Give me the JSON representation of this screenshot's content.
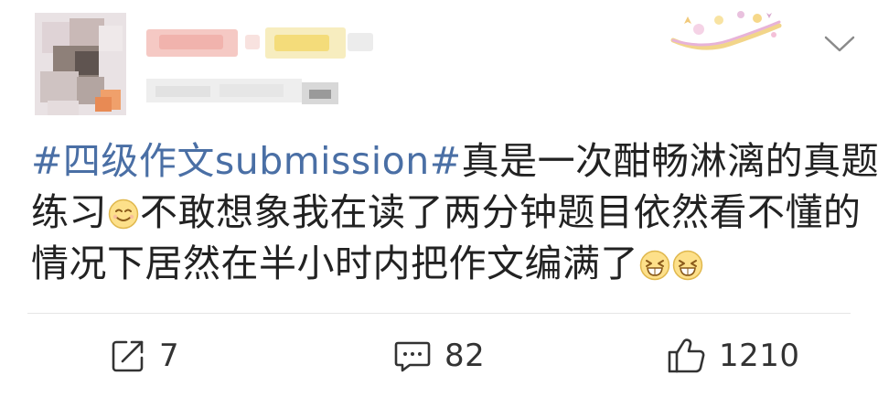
{
  "post": {
    "hashtag": "#四级作文submission#",
    "text_line1_rest": "真是一次酣畅淋漓的真题",
    "text_line2_a": "练习",
    "text_line2_b": "不敢想象我在读了两分钟题目依然看不懂的",
    "text_line3": "情况下居然在半小时内把作文编满了",
    "emoji_line2": "smile-emoji",
    "emoji_line3": [
      "grin-emoji",
      "grin-emoji"
    ]
  },
  "actions": {
    "repost_count": "7",
    "comment_count": "82",
    "like_count": "1210"
  },
  "icons": {
    "repost": "share-icon",
    "comment": "comment-icon",
    "like": "thumbs-up-icon",
    "more": "chevron-down-icon"
  },
  "colors": {
    "hashtag": "#4a6fa5",
    "text": "#222222",
    "icon": "#333333"
  }
}
